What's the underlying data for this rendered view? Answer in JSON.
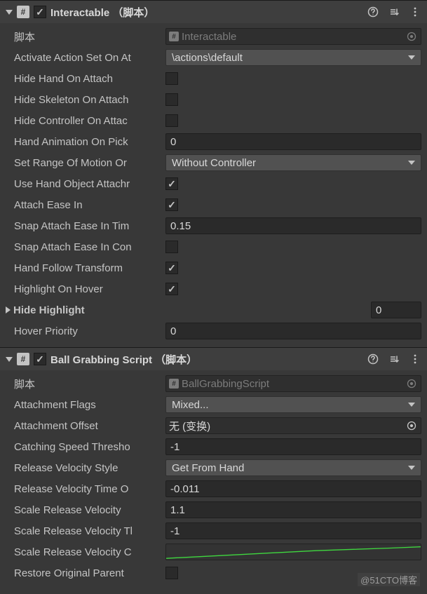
{
  "comp1": {
    "title": "Interactable  （脚本）",
    "rows": {
      "script_label": "脚本",
      "script_value": "Interactable",
      "activate_label": "Activate Action Set On At",
      "activate_value": "\\actions\\default",
      "hidehand_label": "Hide Hand On Attach",
      "hideskeleton_label": "Hide Skeleton On Attach",
      "hidecontroller_label": "Hide Controller On Attac",
      "handanim_label": "Hand Animation On Pick",
      "handanim_value": "0",
      "range_label": "Set Range Of Motion Or",
      "range_value": "Without Controller",
      "usehand_label": "Use Hand Object Attachr",
      "attachease_label": "Attach Ease In",
      "snaptime_label": "Snap Attach Ease In Tim",
      "snaptime_value": "0.15",
      "snapcon_label": "Snap Attach Ease In Con",
      "handfollow_label": "Hand Follow Transform",
      "highlight_label": "Highlight On Hover",
      "hidehl_label": "Hide Highlight",
      "hidehl_value": "0",
      "hover_label": "Hover Priority",
      "hover_value": "0"
    }
  },
  "comp2": {
    "title": "Ball Grabbing Script  （脚本）",
    "rows": {
      "script_label": "脚本",
      "script_value": "BallGrabbingScript",
      "attflags_label": "Attachment Flags",
      "attflags_value": "Mixed...",
      "attoffset_label": "Attachment Offset",
      "attoffset_value": "无 (变换)",
      "catch_label": "Catching Speed Thresho",
      "catch_value": "-1",
      "relstyle_label": "Release Velocity Style",
      "relstyle_value": "Get From Hand",
      "reltime_label": "Release Velocity Time O",
      "reltime_value": "-0.011",
      "scalevel_label": "Scale Release Velocity",
      "scalevel_value": "1.1",
      "scalevelt_label": "Scale Release Velocity Tl",
      "scalevelt_value": "-1",
      "scalevelc_label": "Scale Release Velocity C",
      "restore_label": "Restore Original Parent"
    }
  },
  "watermark": "@51CTO博客"
}
